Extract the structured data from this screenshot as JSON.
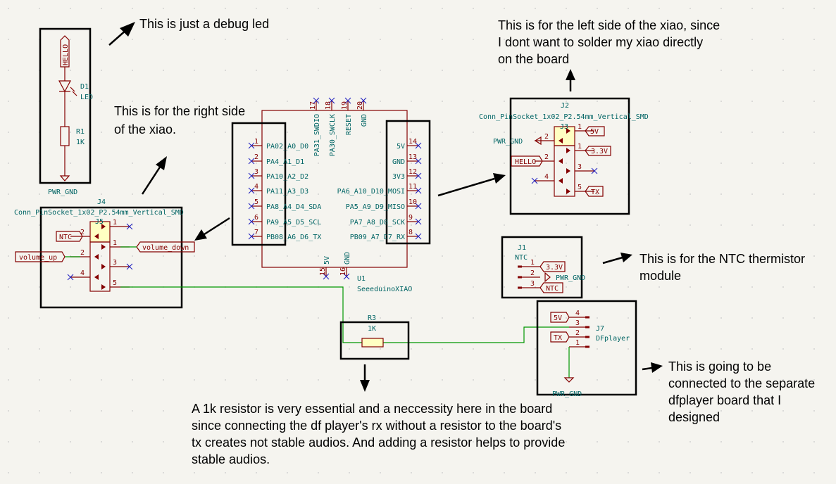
{
  "colors": {
    "background": "#f5f4ef",
    "symbol": "#840000",
    "text": "#006464",
    "wire": "#009600",
    "no_connect": "#2020c0",
    "connector_fill": "#ffffc2",
    "annotation": "#000000"
  },
  "annotations": {
    "debug_led": "This is just a debug led",
    "right_side": [
      "This is for the right side",
      "of the xiao."
    ],
    "left_side": [
      "This is for the left side of the xiao, since",
      "I dont want to solder my xiao directly",
      "on the board"
    ],
    "ntc": [
      "This is for the NTC thermistor",
      "module"
    ],
    "dfplayer": [
      "This is going to be",
      "connected to the separate",
      "dfplayer board that I",
      "designed"
    ],
    "resistor": [
      "A 1k resistor is very essential and a neccessity here in the board",
      "since connecting the df player's rx without a resistor to the board's",
      "tx creates not stable audios. And adding a resistor helps to provide",
      "stable audios."
    ]
  },
  "led_block": {
    "net_label": "HELLO",
    "d_ref": "D1",
    "d_value": "LED",
    "r_ref": "R1",
    "r_value": "1K",
    "gnd": "PWR_GND"
  },
  "u1": {
    "ref": "U1",
    "value": "SeeeduinoXIAO",
    "left_pins": [
      {
        "num": "1",
        "name": "PA02_A0_D0"
      },
      {
        "num": "2",
        "name": "PA4_A1_D1"
      },
      {
        "num": "3",
        "name": "PA10_A2_D2"
      },
      {
        "num": "4",
        "name": "PA11_A3_D3"
      },
      {
        "num": "5",
        "name": "PA8_A4_D4_SDA"
      },
      {
        "num": "6",
        "name": "PA9_A5_D5_SCL"
      },
      {
        "num": "7",
        "name": "PB08_A6_D6_TX"
      }
    ],
    "right_pins": [
      {
        "num": "14",
        "name": "5V"
      },
      {
        "num": "13",
        "name": "GND"
      },
      {
        "num": "12",
        "name": "3V3"
      },
      {
        "num": "11",
        "name": "PA6_A10_D10_MOSI"
      },
      {
        "num": "10",
        "name": "PA5_A9_D9_MISO"
      },
      {
        "num": "9",
        "name": "PA7_A8_D8_SCK"
      },
      {
        "num": "8",
        "name": "PB09_A7_D7_RX"
      }
    ],
    "top_pins": [
      {
        "num": "17",
        "name": "PA31_SWDIO"
      },
      {
        "num": "18",
        "name": "PA30_SWCLK"
      },
      {
        "num": "19",
        "name": "RESET"
      },
      {
        "num": "20",
        "name": "GND"
      }
    ],
    "bottom_pins": [
      {
        "num": "15",
        "name": "5V"
      },
      {
        "num": "16",
        "name": "GND"
      }
    ]
  },
  "j4": {
    "ref": "J4",
    "value": "Conn_PinSocket_1x02_P2.54mm_Vertical_SMD",
    "inner_ref": "J5",
    "pins": [
      "1",
      "2",
      "1",
      "2",
      "3",
      "4",
      "5"
    ],
    "labels": {
      "ntc": "NTC",
      "volume_down": "volume_down",
      "volume_up": "volume_up"
    }
  },
  "j2": {
    "ref": "J2",
    "value": "Conn_PinSocket_1x02_P2.54mm_Vertical_SMD",
    "inner_ref": "J3",
    "pins": [
      "1",
      "2",
      "1",
      "2",
      "3",
      "4",
      "5"
    ],
    "labels": {
      "v5": "5V",
      "gnd": "PWR_GND",
      "v33": "3.3V",
      "hello": "HELLO",
      "tx": "TX"
    }
  },
  "j1": {
    "ref": "J1",
    "value": "NTC",
    "pins": [
      "1",
      "2",
      "3"
    ],
    "labels": {
      "v33": "3.3V",
      "gnd": "PWR_GND",
      "ntc": "NTC"
    }
  },
  "r3": {
    "ref": "R3",
    "value": "1K"
  },
  "j7": {
    "ref": "J7",
    "value": "DFplayer",
    "pins": [
      "4",
      "3",
      "2",
      "1"
    ],
    "labels": {
      "v5": "5V",
      "tx": "TX",
      "gnd": "PWR_GND"
    }
  }
}
